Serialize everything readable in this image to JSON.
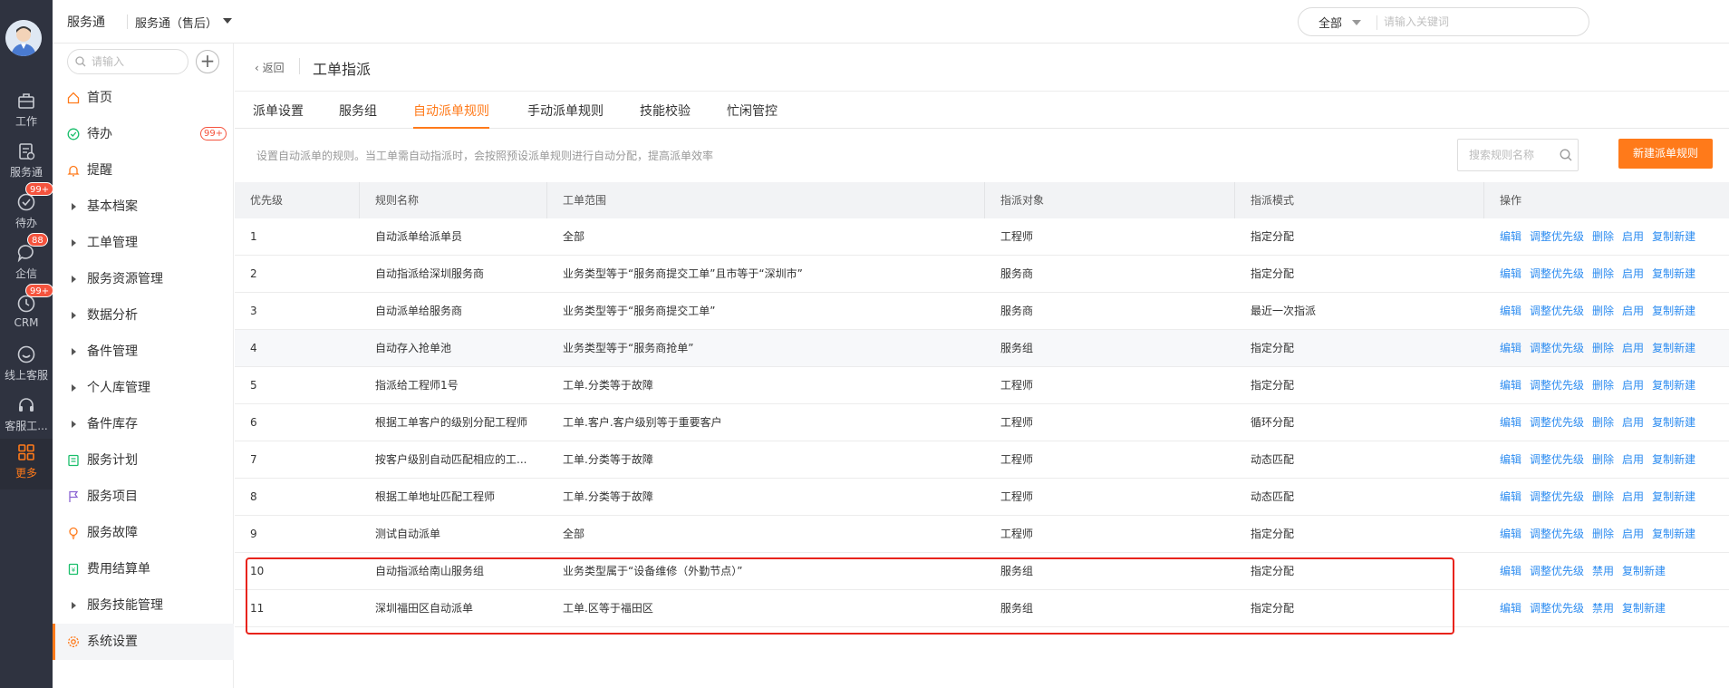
{
  "rail": {
    "items": [
      {
        "label": "工作",
        "icon": "briefcase-icon"
      },
      {
        "label": "服务通",
        "icon": "service-icon"
      },
      {
        "label": "待办",
        "icon": "todo-check-icon",
        "badge": "99+"
      },
      {
        "label": "企信",
        "icon": "chat-icon",
        "badge": "88"
      },
      {
        "label": "CRM",
        "icon": "clock-icon",
        "badge": "99+"
      },
      {
        "label": "线上客服",
        "icon": "online-service-icon"
      },
      {
        "label": "客服工...",
        "icon": "headset-icon"
      },
      {
        "label": "更多",
        "icon": "grid-icon",
        "active": true
      }
    ]
  },
  "header": {
    "app_name": "服务通",
    "sub_app": "服务通（售后）",
    "search_scope": "全部",
    "search_placeholder": "请输入关键词"
  },
  "sidenav": {
    "search_placeholder": "请输入",
    "add_label": "+",
    "items": [
      {
        "label": "首页",
        "icon": "home-icon"
      },
      {
        "label": "待办",
        "icon": "todo-check-icon",
        "badge": "99+"
      },
      {
        "label": "提醒",
        "icon": "bell-icon"
      },
      {
        "label": "基本档案",
        "icon": "caret-right-icon"
      },
      {
        "label": "工单管理",
        "icon": "caret-right-icon"
      },
      {
        "label": "服务资源管理",
        "icon": "caret-right-icon"
      },
      {
        "label": "数据分析",
        "icon": "caret-right-icon"
      },
      {
        "label": "备件管理",
        "icon": "caret-right-icon"
      },
      {
        "label": "个人库管理",
        "icon": "caret-right-icon"
      },
      {
        "label": "备件库存",
        "icon": "caret-right-icon"
      },
      {
        "label": "服务计划",
        "icon": "plan-icon"
      },
      {
        "label": "服务项目",
        "icon": "flag-icon"
      },
      {
        "label": "服务故障",
        "icon": "bulb-icon"
      },
      {
        "label": "费用结算单",
        "icon": "receipt-icon"
      },
      {
        "label": "服务技能管理",
        "icon": "caret-right-icon"
      },
      {
        "label": "系统设置",
        "icon": "gear-icon",
        "active": true
      }
    ]
  },
  "main": {
    "back_label": "返回",
    "title": "工单指派",
    "tabs": [
      {
        "label": "派单设置"
      },
      {
        "label": "服务组"
      },
      {
        "label": "自动派单规则",
        "active": true
      },
      {
        "label": "手动派单规则"
      },
      {
        "label": "技能校验"
      },
      {
        "label": "忙闲管控"
      }
    ],
    "hint": "设置自动派单的规则。当工单需自动指派时，会按照预设派单规则进行自动分配，提高派单效率",
    "rule_search_placeholder": "搜索规则名称",
    "new_rule_button": "新建派单规则",
    "table": {
      "columns": [
        "优先级",
        "规则名称",
        "工单范围",
        "指派对象",
        "指派模式",
        "操作"
      ],
      "rows": [
        {
          "priority": "1",
          "name": "自动派单给派单员",
          "scope": "全部",
          "target": "工程师",
          "mode": "指定分配",
          "ops": [
            "编辑",
            "调整优先级",
            "删除",
            "启用",
            "复制新建"
          ]
        },
        {
          "priority": "2",
          "name": "自动指派给深圳服务商",
          "scope": "业务类型等于“服务商提交工单”且市等于“深圳市”",
          "target": "服务商",
          "mode": "指定分配",
          "ops": [
            "编辑",
            "调整优先级",
            "删除",
            "启用",
            "复制新建"
          ]
        },
        {
          "priority": "3",
          "name": "自动派单给服务商",
          "scope": "业务类型等于“服务商提交工单”",
          "target": "服务商",
          "mode": "最近一次指派",
          "ops": [
            "编辑",
            "调整优先级",
            "删除",
            "启用",
            "复制新建"
          ]
        },
        {
          "priority": "4",
          "name": "自动存入抢单池",
          "scope": "业务类型等于“服务商抢单”",
          "target": "服务组",
          "mode": "指定分配",
          "ops": [
            "编辑",
            "调整优先级",
            "删除",
            "启用",
            "复制新建"
          ],
          "highlight": true
        },
        {
          "priority": "5",
          "name": "指派给工程师1号",
          "scope": "工单.分类等于故障",
          "target": "工程师",
          "mode": "指定分配",
          "ops": [
            "编辑",
            "调整优先级",
            "删除",
            "启用",
            "复制新建"
          ]
        },
        {
          "priority": "6",
          "name": "根据工单客户的级别分配工程师",
          "scope": "工单.客户.客户级别等于重要客户",
          "target": "工程师",
          "mode": "循环分配",
          "ops": [
            "编辑",
            "调整优先级",
            "删除",
            "启用",
            "复制新建"
          ]
        },
        {
          "priority": "7",
          "name": "按客户级别自动匹配相应的工...",
          "scope": "工单.分类等于故障",
          "target": "工程师",
          "mode": "动态匹配",
          "ops": [
            "编辑",
            "调整优先级",
            "删除",
            "启用",
            "复制新建"
          ]
        },
        {
          "priority": "8",
          "name": "根据工单地址匹配工程师",
          "scope": "工单.分类等于故障",
          "target": "工程师",
          "mode": "动态匹配",
          "ops": [
            "编辑",
            "调整优先级",
            "删除",
            "启用",
            "复制新建"
          ]
        },
        {
          "priority": "9",
          "name": "测试自动派单",
          "scope": "全部",
          "target": "工程师",
          "mode": "指定分配",
          "ops": [
            "编辑",
            "调整优先级",
            "删除",
            "启用",
            "复制新建"
          ]
        },
        {
          "priority": "10",
          "name": "自动指派给南山服务组",
          "scope": "业务类型属于“设备维修（外勤节点）”",
          "target": "服务组",
          "mode": "指定分配",
          "ops": [
            "编辑",
            "调整优先级",
            "禁用",
            "复制新建"
          ]
        },
        {
          "priority": "11",
          "name": "深圳福田区自动派单",
          "scope": "工单.区等于福田区",
          "target": "服务组",
          "mode": "指定分配",
          "ops": [
            "编辑",
            "调整优先级",
            "禁用",
            "复制新建"
          ]
        }
      ]
    }
  },
  "colors": {
    "accent": "#ff7a1a",
    "link": "#2d8cf0",
    "rail_bg": "#2f3340",
    "annotation": "#e8231b"
  }
}
